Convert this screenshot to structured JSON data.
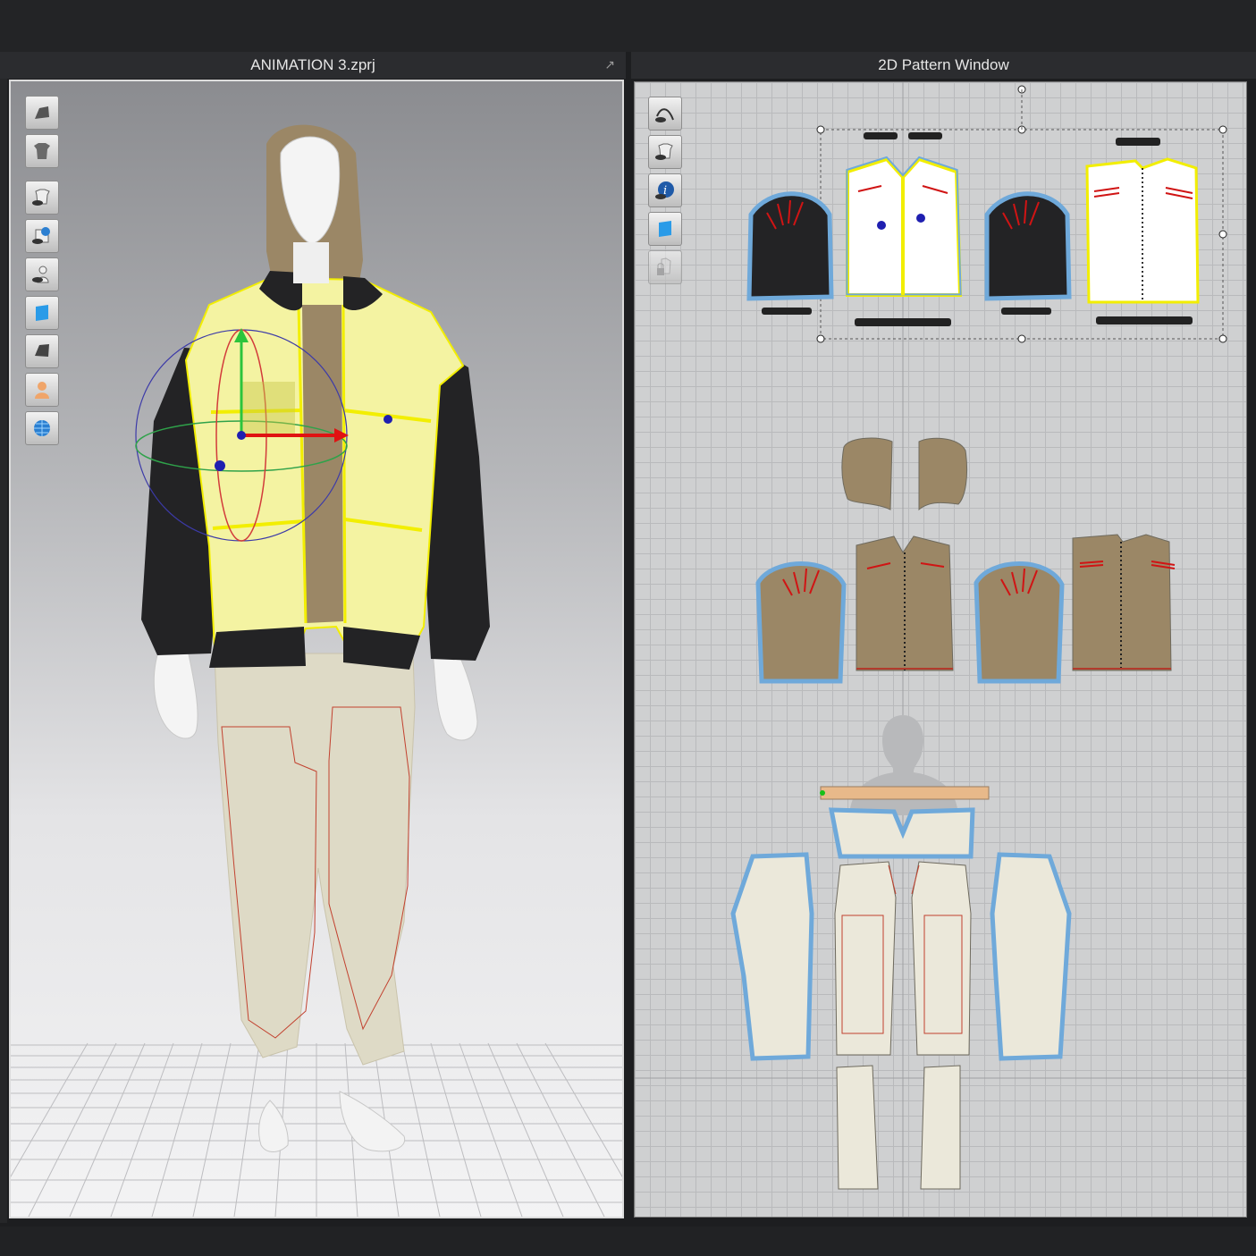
{
  "window": {
    "left_title": "ANIMATION 3.zprj",
    "right_title": "2D Pattern Window"
  },
  "toolbar3d": {
    "tools": [
      "avatar-display-icon",
      "garment-display-icon",
      "garment-visibility-icon",
      "texture-visibility-icon",
      "avatar-visibility-icon",
      "fabric-icon",
      "render-solid-icon",
      "avatar-skin-icon",
      "environment-icon"
    ]
  },
  "toolbar2d": {
    "tools": [
      "pattern-tool-icon",
      "garment-visibility-icon",
      "info-icon",
      "fabric-icon",
      "lock-icon"
    ]
  },
  "colors": {
    "jacket_body": "#f4f3a2",
    "sleeve": "#232325",
    "hood": "#9b8766",
    "pants": "#dedac6",
    "selected_outline": "#f2ee00",
    "seam_blue": "#6fa9da",
    "dart_red": "#d01414"
  }
}
